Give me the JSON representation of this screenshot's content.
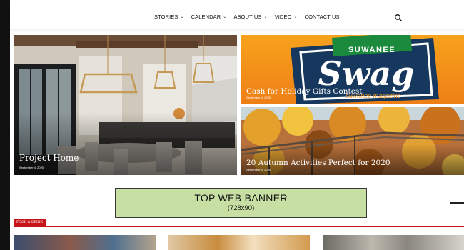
{
  "nav": {
    "items": [
      {
        "label": "STORIES",
        "has_dropdown": true
      },
      {
        "label": "CALENDAR",
        "has_dropdown": true
      },
      {
        "label": "ABOUT US",
        "has_dropdown": true
      },
      {
        "label": "VIDEO",
        "has_dropdown": true
      },
      {
        "label": "CONTACT US",
        "has_dropdown": false
      }
    ],
    "search_icon": "search-icon"
  },
  "featured": [
    {
      "title": "Project Home",
      "date": "September 4, 2020"
    },
    {
      "title": "Cash for Holiday Gifts Contest",
      "date": "September 4, 2020",
      "logo_top": "SUWANEE",
      "logo_main": "Swag",
      "logo_sub": "suwanee magazine"
    },
    {
      "title": "20 Autumn Activities Perfect for 2020",
      "date": "September 4, 2020"
    }
  ],
  "banner": {
    "title": "TOP WEB BANNER",
    "size": "(728x90)"
  },
  "category": {
    "label": "FOOD & DRINK"
  },
  "colors": {
    "accent": "#c7141b",
    "banner_bg": "#c8dfa4",
    "swag_orange": "#f39219",
    "logo_navy": "#17385e",
    "logo_green": "#1b8a3c"
  }
}
